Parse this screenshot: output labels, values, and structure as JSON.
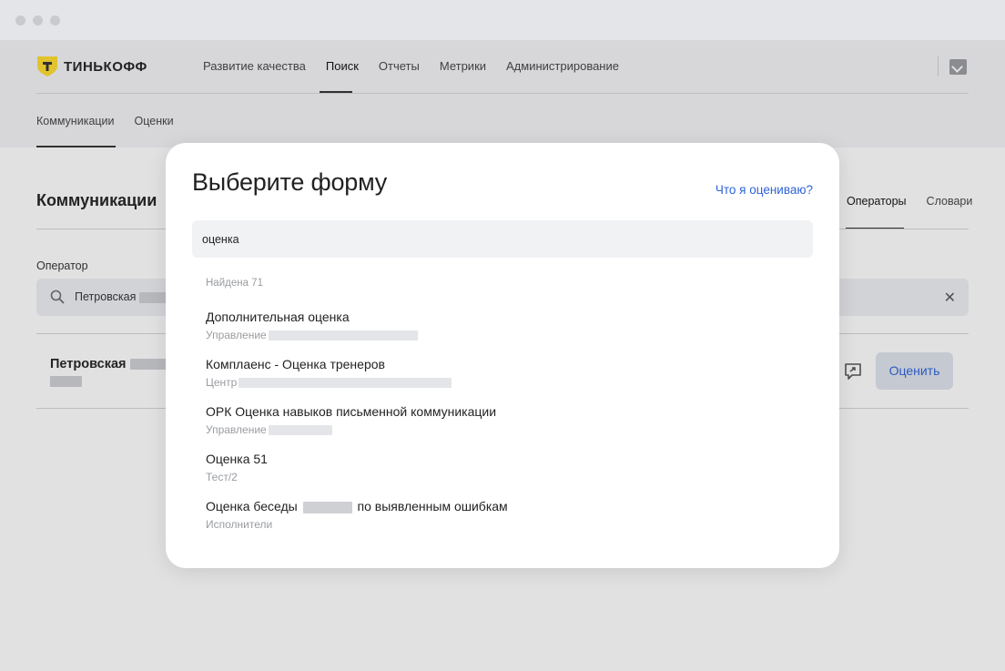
{
  "app": {
    "brand": "ТИНЬКОФФ",
    "topnav": [
      {
        "label": "Развитие качества",
        "active": false
      },
      {
        "label": "Поиск",
        "active": true
      },
      {
        "label": "Отчеты",
        "active": false
      },
      {
        "label": "Метрики",
        "active": false
      },
      {
        "label": "Администрирование",
        "active": false
      }
    ],
    "subnav": [
      {
        "label": "Коммуникации",
        "active": true
      },
      {
        "label": "Оценки",
        "active": false
      }
    ],
    "page_title": "Коммуникации",
    "right_tabs": [
      {
        "label": "Операторы",
        "active": true
      },
      {
        "label": "Словари",
        "active": false
      }
    ],
    "operator_filter": {
      "label": "Оператор",
      "value": "Петровская"
    },
    "result": {
      "name": "Петровская",
      "rate_label": "Оценить"
    }
  },
  "modal": {
    "title": "Выберите форму",
    "help_link": "Что я оцениваю?",
    "search_value": "оценка",
    "found_text": "Найдена 71",
    "items": [
      {
        "title": "Дополнительная оценка",
        "subtitle": "Управление"
      },
      {
        "title": "Комплаенс - Оценка тренеров",
        "subtitle": "Центр"
      },
      {
        "title": "ОРК Оценка навыков письменной коммуникации",
        "subtitle": "Управление"
      },
      {
        "title": "Оценка 51",
        "subtitle": "Тест/2"
      },
      {
        "title_prefix": "Оценка беседы",
        "title_suffix": "по выявленным ошибкам",
        "subtitle": "Исполнители"
      }
    ]
  },
  "colors": {
    "accent": "#2d63d8",
    "brand_yellow": "#ffdd2d"
  }
}
